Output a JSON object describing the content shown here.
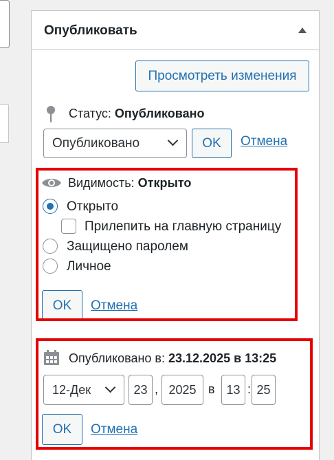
{
  "publish_box": {
    "title": "Опубликовать",
    "preview_button": "Просмотреть изменения",
    "status": {
      "label": "Статус:",
      "value": "Опубликовано",
      "select_value": "Опубликовано",
      "ok": "OK",
      "cancel": "Отмена"
    },
    "visibility": {
      "label": "Видимость:",
      "value": "Открыто",
      "options": [
        {
          "label": "Открыто",
          "checked": true
        },
        {
          "label": "Прилепить на главную страницу",
          "checked": false
        },
        {
          "label": "Защищено паролем",
          "checked": false
        },
        {
          "label": "Личное",
          "checked": false
        }
      ],
      "ok": "OK",
      "cancel": "Отмена"
    },
    "published": {
      "label": "Опубликовано в:",
      "value": "23.12.2025 в 13:25",
      "month": "12-Дек",
      "day": "23",
      "comma": ",",
      "year": "2025",
      "at": "в",
      "hour": "13",
      "colon": ":",
      "minute": "25",
      "ok": "OK",
      "cancel": "Отмена"
    }
  },
  "colors": {
    "accent": "#2271b1",
    "highlight": "#e60000",
    "text": "#1d2327",
    "border": "#c3c4c7"
  }
}
